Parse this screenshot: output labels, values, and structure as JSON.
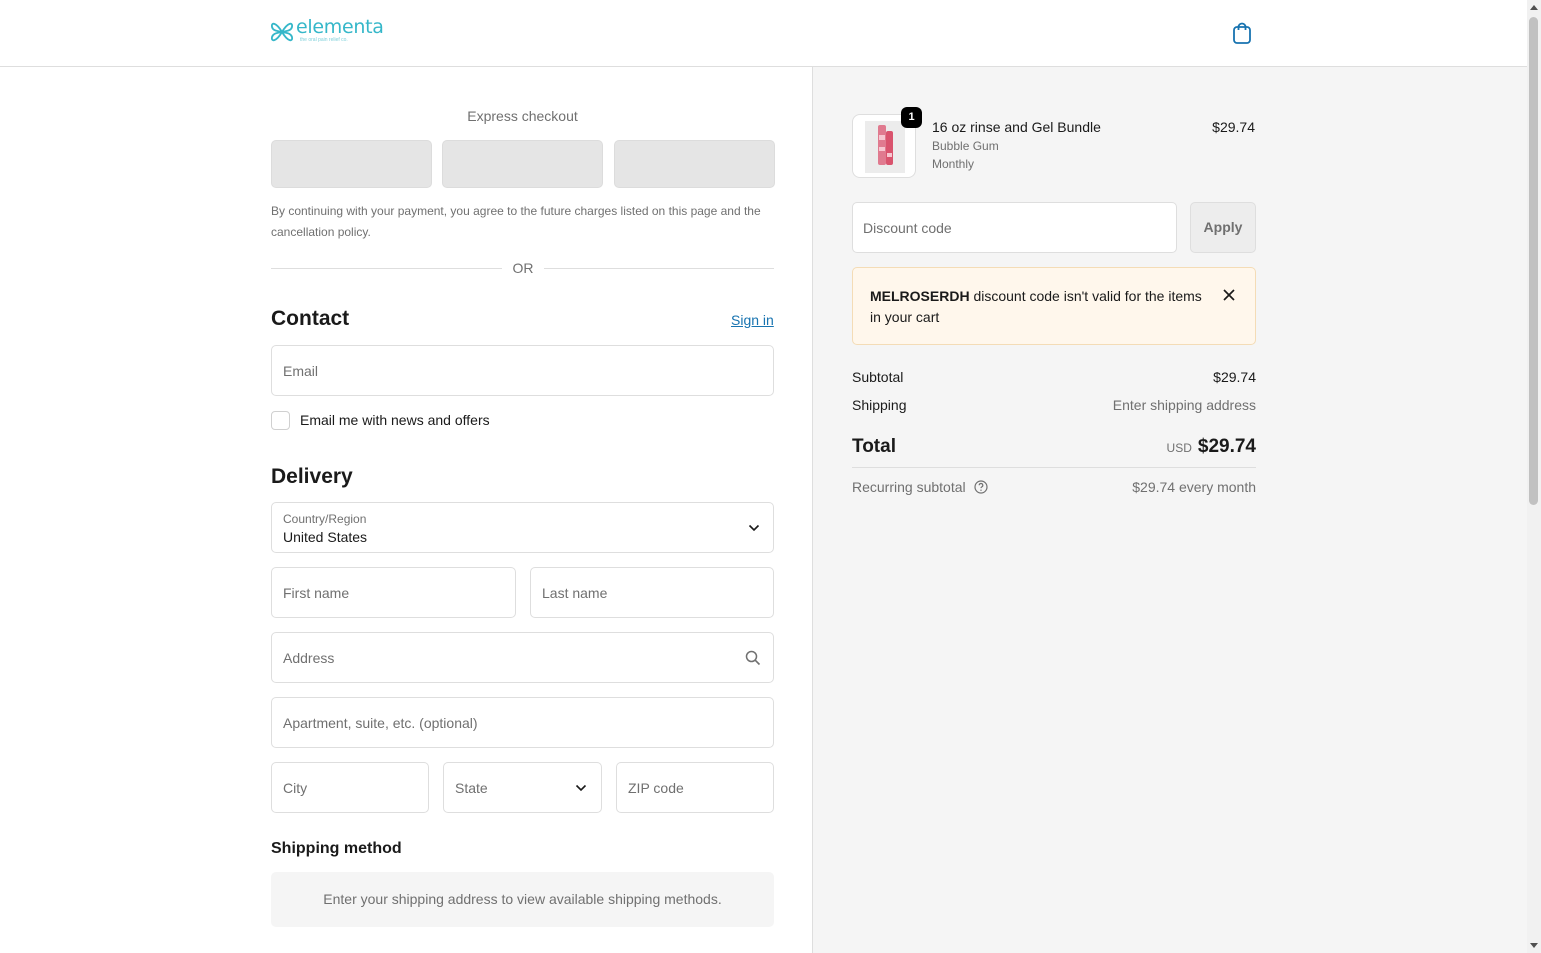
{
  "brand": {
    "name": "elementa",
    "tagline": "the oral pain relief co."
  },
  "colors": {
    "brand": "#35b7c9",
    "link": "#1773b0",
    "warning_bg": "#fff7ec"
  },
  "header": {
    "cart_icon": "shopping-bag-icon"
  },
  "express": {
    "title": "Express checkout",
    "consent": "By continuing with your payment, you agree to the future charges listed on this page and the cancellation policy.",
    "divider": "OR"
  },
  "contact": {
    "title": "Contact",
    "sign_in": "Sign in",
    "email_placeholder": "Email",
    "newsletter_label": "Email me with news and offers"
  },
  "delivery": {
    "title": "Delivery",
    "country_label": "Country/Region",
    "country_value": "United States",
    "first_name_placeholder": "First name",
    "last_name_placeholder": "Last name",
    "address_placeholder": "Address",
    "apartment_placeholder": "Apartment, suite, etc. (optional)",
    "city_placeholder": "City",
    "state_placeholder": "State",
    "zip_placeholder": "ZIP code"
  },
  "shipping_method": {
    "title": "Shipping method",
    "message": "Enter your shipping address to view available shipping methods."
  },
  "order": {
    "item": {
      "quantity": "1",
      "name": "16 oz rinse and Gel Bundle",
      "variant": "Bubble Gum",
      "plan": "Monthly",
      "price": "$29.74"
    },
    "discount_placeholder": "Discount code",
    "apply_label": "Apply",
    "alert": {
      "code": "MELROSERDH",
      "message": " discount code isn't valid for the items in your cart"
    },
    "subtotal_label": "Subtotal",
    "subtotal_value": "$29.74",
    "shipping_label": "Shipping",
    "shipping_value": "Enter shipping address",
    "total_label": "Total",
    "total_currency": "USD",
    "total_value": "$29.74",
    "recurring_label": "Recurring subtotal",
    "recurring_value": "$29.74 every month"
  }
}
